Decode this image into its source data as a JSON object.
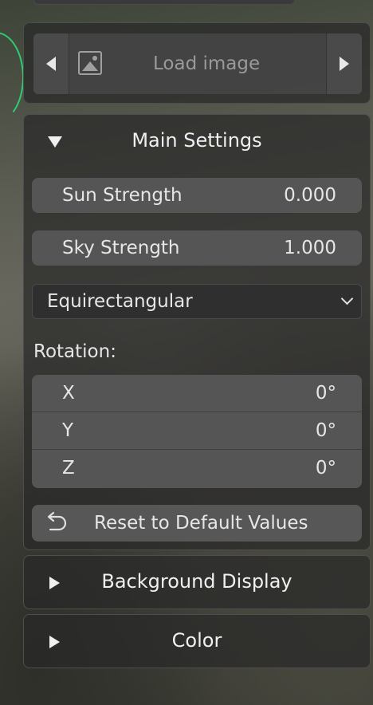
{
  "image_selector": {
    "label": "Load image",
    "prev_icon": "triangle-left-icon",
    "next_icon": "triangle-right-icon",
    "image_icon": "image-icon"
  },
  "main_settings": {
    "title": "Main Settings",
    "expanded": true,
    "sun_strength": {
      "label": "Sun Strength",
      "value": "0.000"
    },
    "sky_strength": {
      "label": "Sky Strength",
      "value": "1.000"
    },
    "projection": {
      "selected": "Equirectangular"
    },
    "rotation": {
      "label": "Rotation:",
      "axes": [
        {
          "label": "X",
          "value": "0°"
        },
        {
          "label": "Y",
          "value": "0°"
        },
        {
          "label": "Z",
          "value": "0°"
        }
      ]
    },
    "reset_button": {
      "label": "Reset to Default Values",
      "icon": "undo-icon"
    }
  },
  "background_display": {
    "title": "Background Display",
    "expanded": false
  },
  "color": {
    "title": "Color",
    "expanded": false
  },
  "colors": {
    "panel_bg": "#282828",
    "field_bg": "#555555",
    "accent_green": "#2ecc71"
  }
}
